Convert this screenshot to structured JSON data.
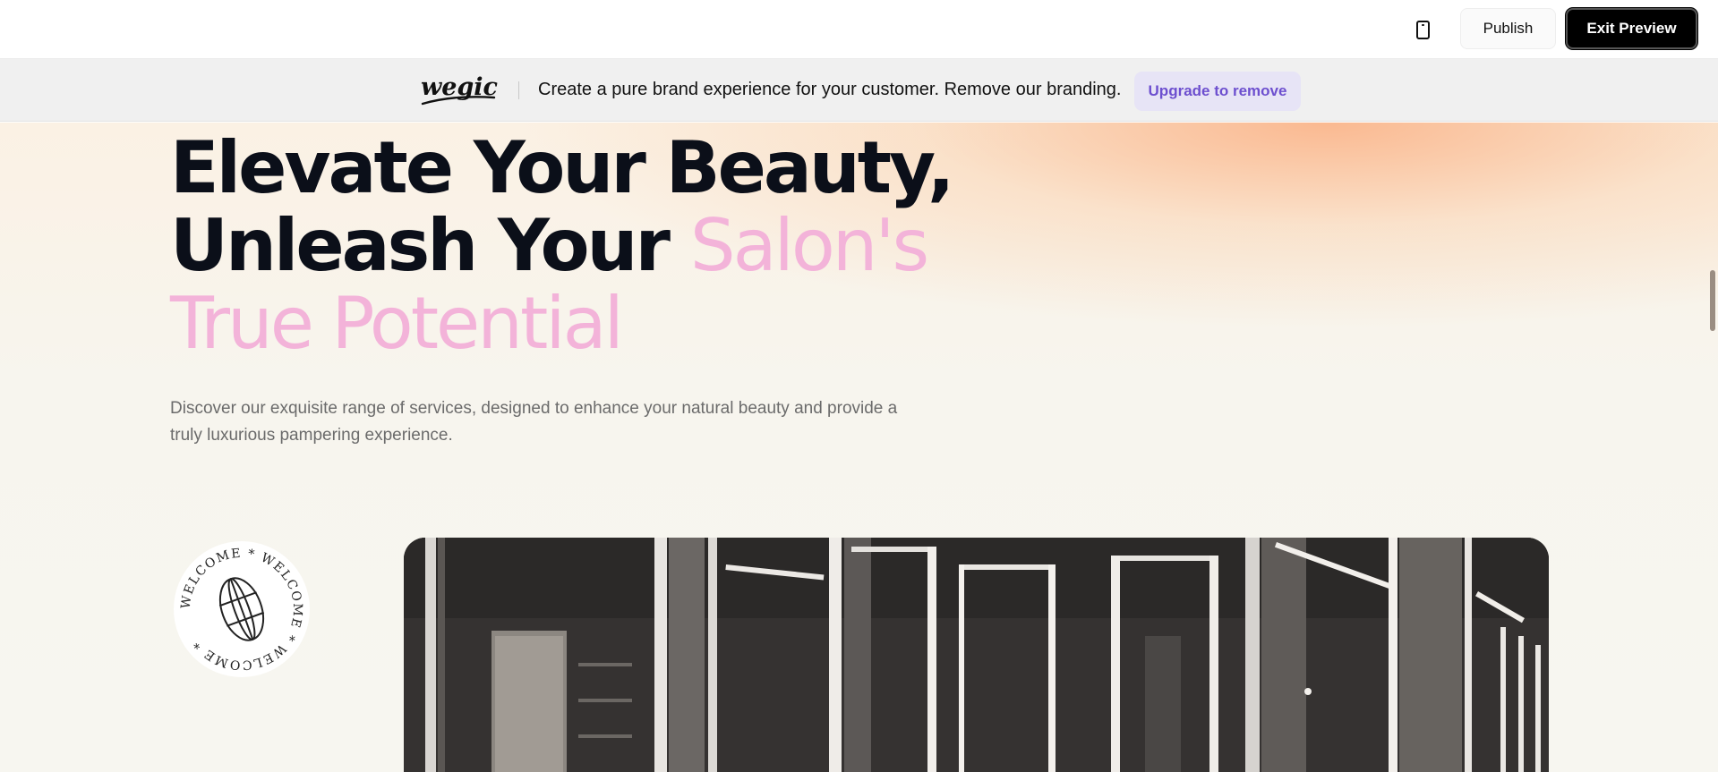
{
  "toolbar": {
    "device_icon": "mobile-phone-icon",
    "publish_label": "Publish",
    "exit_preview_label": "Exit Preview"
  },
  "banner": {
    "logo_text": "wegic",
    "text": "Create a pure brand experience for your customer. Remove our branding.",
    "upgrade_label": "Upgrade to remove"
  },
  "hero": {
    "headline_line1": "Elevate Your Beauty,",
    "headline_line2_dark": "Unleash Your ",
    "headline_line2_accent": "Salon's",
    "headline_line3_accent": "True Potential",
    "subtext": "Discover our exquisite range of services, designed to enhance your natural beauty and provide a truly luxurious pampering experience.",
    "badge_text": "WELCOME * WELCOME * WELCOME *",
    "badge_icon": "globe-icon",
    "image_alt": "salon interior with illuminated mirror stations"
  },
  "colors": {
    "accent_pink": "#f3b3d9",
    "upgrade_purple": "#6d4fcf",
    "upgrade_bg": "#e7e4f6",
    "headline_dark": "#0b0f19"
  }
}
